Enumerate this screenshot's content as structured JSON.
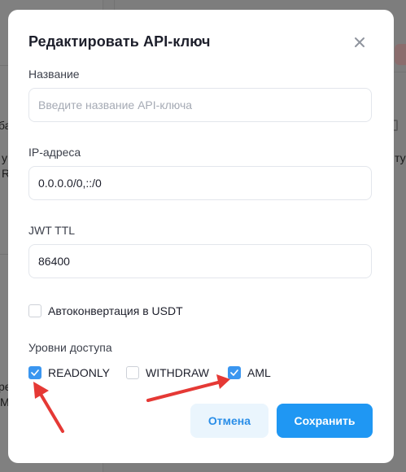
{
  "background": {
    "fragments": [
      "ба",
      "у",
      "R",
      "ре",
      "М",
      "ту"
    ]
  },
  "modal": {
    "title": "Редактировать API-ключ",
    "close_icon": "close-icon",
    "fields": {
      "name": {
        "label": "Название",
        "value": "",
        "placeholder": "Введите название API-ключа"
      },
      "ip": {
        "label": "IP-адреса",
        "value": "0.0.0.0/0,::/0"
      },
      "jwt": {
        "label": "JWT TTL",
        "value": "86400"
      }
    },
    "auto_convert": {
      "label": "Автоконвертация в USDT",
      "checked": false
    },
    "access": {
      "label": "Уровни доступа",
      "options": [
        {
          "label": "READONLY",
          "checked": true
        },
        {
          "label": "WITHDRAW",
          "checked": false
        },
        {
          "label": "AML",
          "checked": true
        }
      ]
    },
    "buttons": {
      "cancel": "Отмена",
      "save": "Сохранить"
    }
  },
  "colors": {
    "accent": "#1f97f3",
    "checkbox_checked": "#3a96f0",
    "annotation_arrow": "#e53935"
  }
}
